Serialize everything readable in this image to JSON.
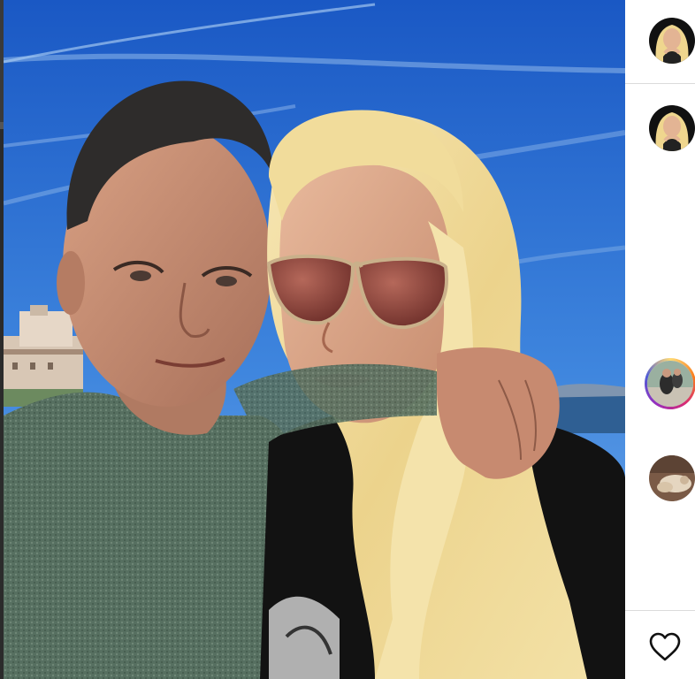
{
  "post": {
    "photo_subject": ""
  },
  "sidebar": {
    "avatars": [
      {
        "kind": "author-avatar"
      },
      {
        "kind": "comment-avatar"
      },
      {
        "kind": "story-avatar",
        "has_story_ring": true
      },
      {
        "kind": "comment-avatar"
      }
    ],
    "like_icon": "heart-outline-icon"
  },
  "colors": {
    "sky_top": "#1f63c9",
    "sky_bottom": "#6aa6ea",
    "sweater": "#4f6b5c",
    "hair_blonde": "#f2dfa0",
    "divider": "#dbdbdb",
    "story_ring": "#d62976"
  }
}
